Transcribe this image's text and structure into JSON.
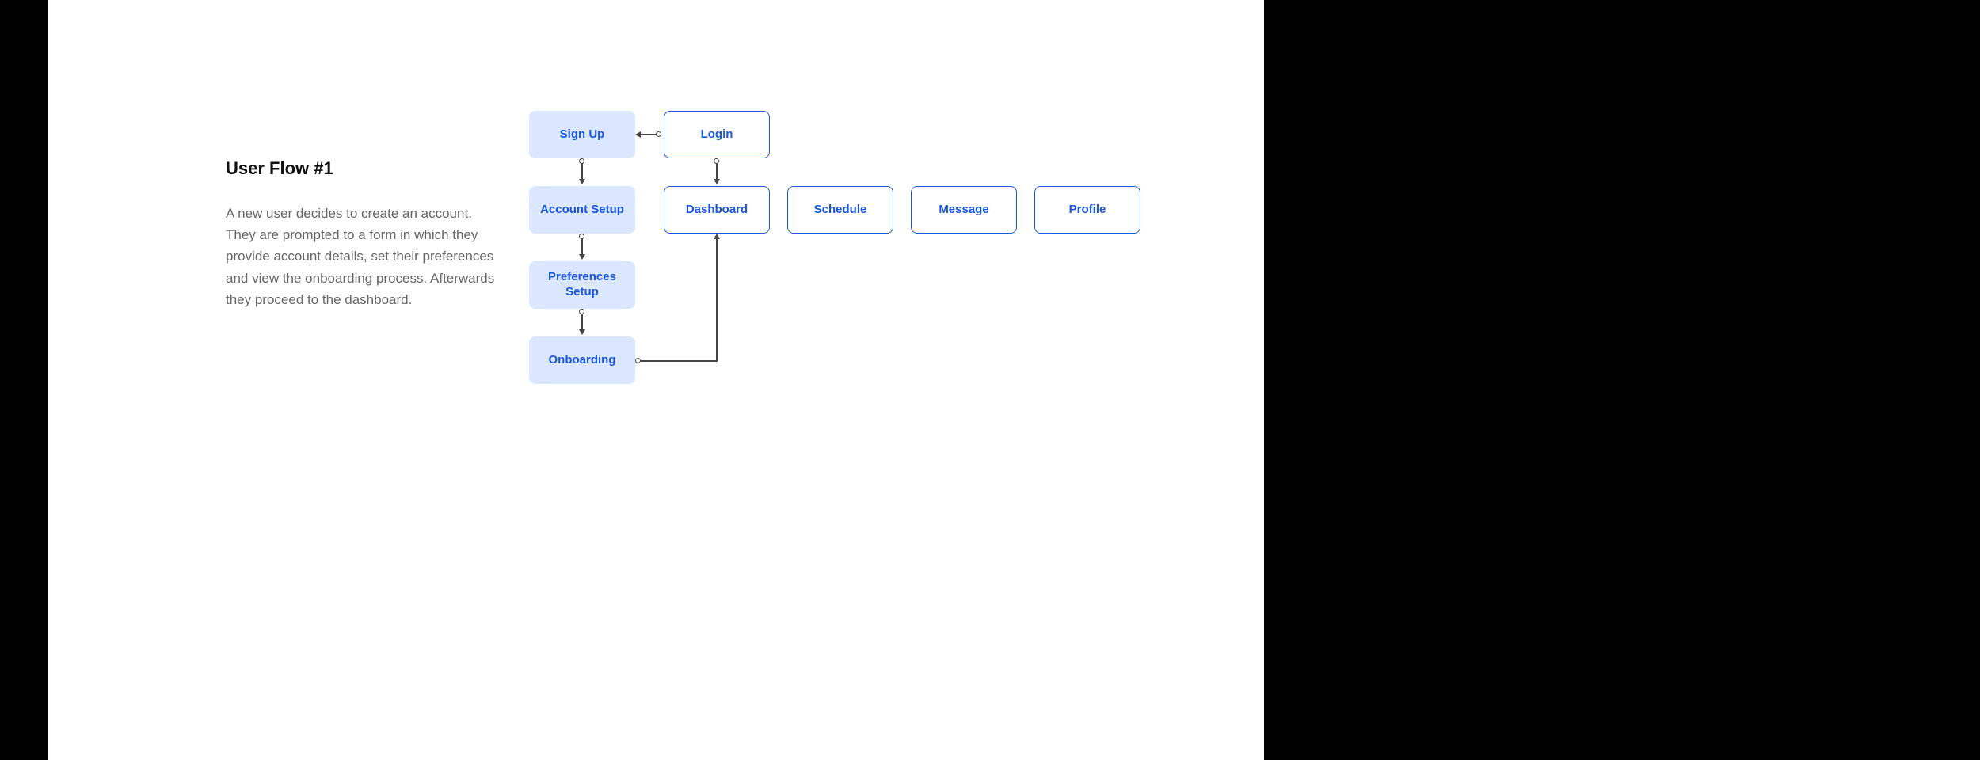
{
  "title": "User Flow #1",
  "description": "A new user decides to create an account. They are prompted to a form in which they provide account details, set their preferences and view the onboarding process. Afterwards they proceed to the dashboard.",
  "nodes": {
    "signup": "Sign Up",
    "account_setup": "Account Setup",
    "preferences_setup": "Preferences Setup",
    "onboarding": "Onboarding",
    "login": "Login",
    "dashboard": "Dashboard",
    "schedule": "Schedule",
    "message": "Message",
    "profile": "Profile"
  },
  "connections": [
    {
      "from": "login",
      "to": "signup",
      "direction": "left"
    },
    {
      "from": "signup",
      "to": "account_setup",
      "direction": "down"
    },
    {
      "from": "account_setup",
      "to": "preferences_setup",
      "direction": "down"
    },
    {
      "from": "preferences_setup",
      "to": "onboarding",
      "direction": "down"
    },
    {
      "from": "login",
      "to": "dashboard",
      "direction": "down"
    },
    {
      "from": "onboarding",
      "to": "dashboard",
      "direction": "elbow-right-up"
    }
  ]
}
